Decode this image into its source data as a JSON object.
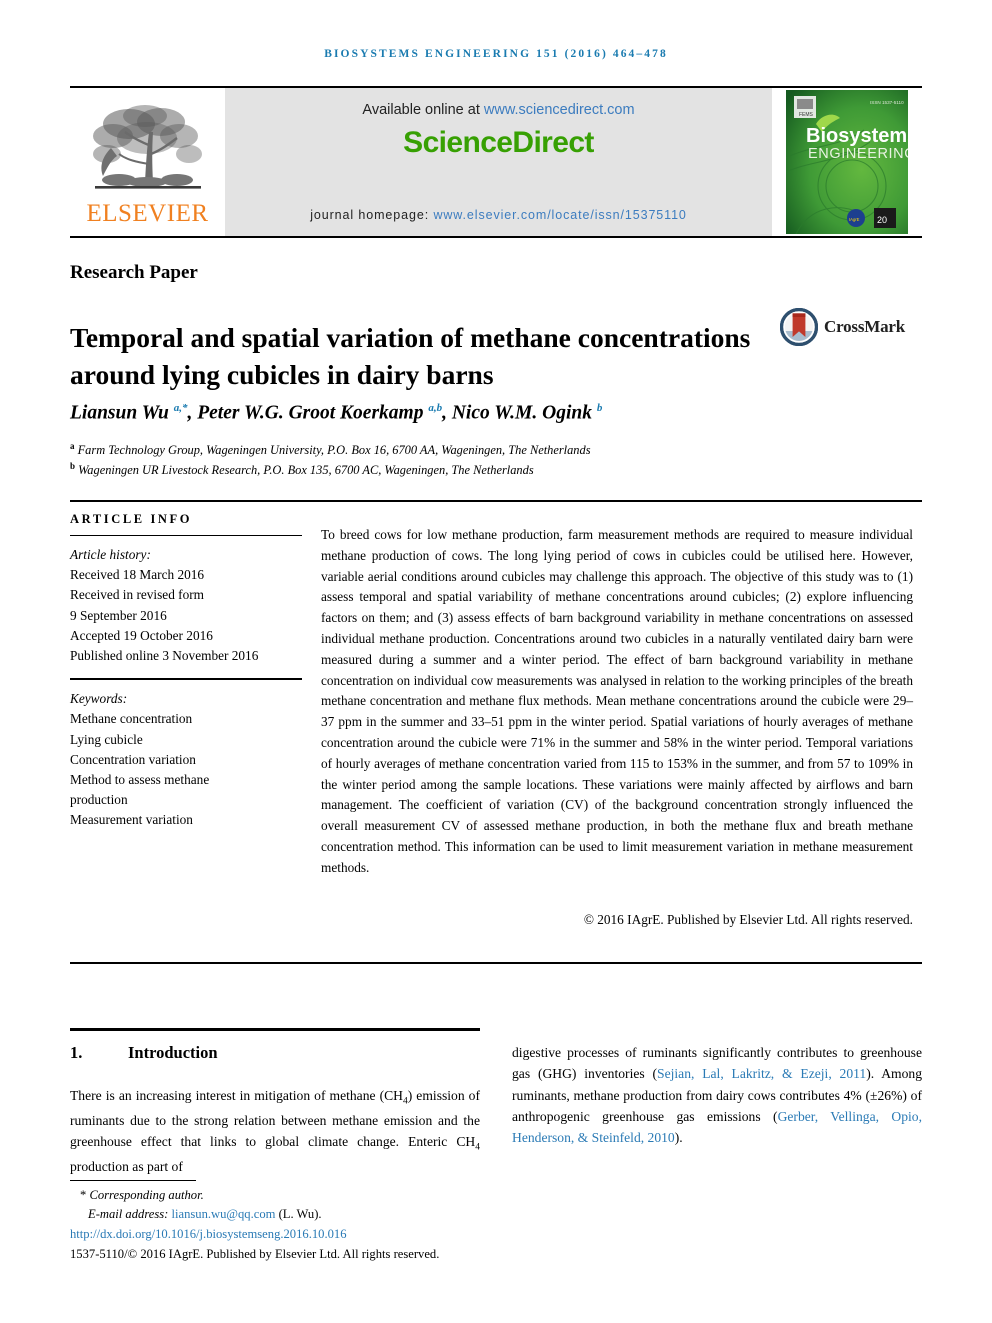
{
  "running_head": "Biosystems Engineering 151 (2016) 464–478",
  "masthead": {
    "publisher_name": "ELSEVIER",
    "available_prefix": "Available online at ",
    "available_url": "www.sciencedirect.com",
    "sciencedirect_logo": "ScienceDirect",
    "homepage_label": "journal homepage: ",
    "homepage_url": "www.elsevier.com/locate/issn/15375110",
    "cover_title_line1": "Biosystems",
    "cover_title_line2": "ENGINEERING",
    "colors": {
      "link_blue": "#3c7cbf",
      "sciencedirect_green": "#37a003",
      "elsevier_orange": "#f08020",
      "running_head_blue": "#1a7bb0",
      "cover_green": "#3d9140"
    }
  },
  "article": {
    "section_type": "Research Paper",
    "title": "Temporal and spatial variation of methane concentrations around lying cubicles in dairy barns",
    "crossmark_label": "CrossMark",
    "authors_html": "Liansun Wu <sup>a,*</sup>, Peter W.G. Groot Koerkamp <sup>a,b</sup>, Nico W.M. Ogink <sup>b</sup>",
    "affiliations": [
      "Farm Technology Group, Wageningen University, P.O. Box 16, 6700 AA, Wageningen, The Netherlands",
      "Wageningen UR Livestock Research, P.O. Box 135, 6700 AC, Wageningen, The Netherlands"
    ],
    "affiliation_markers": [
      "a",
      "b"
    ]
  },
  "article_info": {
    "heading": "ARTICLE INFO",
    "history_label": "Article history:",
    "history": [
      "Received 18 March 2016",
      "Received in revised form",
      "9 September 2016",
      "Accepted 19 October 2016",
      "Published online 3 November 2016"
    ],
    "keywords_label": "Keywords:",
    "keywords": [
      "Methane concentration",
      "Lying cubicle",
      "Concentration variation",
      "Method to assess methane",
      "production",
      "Measurement variation"
    ]
  },
  "abstract": {
    "text": "To breed cows for low methane production, farm measurement methods are required to measure individual methane production of cows. The long lying period of cows in cubicles could be utilised here. However, variable aerial conditions around cubicles may challenge this approach. The objective of this study was to (1) assess temporal and spatial variability of methane concentrations around cubicles; (2) explore influencing factors on them; and (3) assess effects of barn background variability in methane concentrations on assessed individual methane production. Concentrations around two cubicles in a naturally ventilated dairy barn were measured during a summer and a winter period. The effect of barn background variability in methane concentration on individual cow measurements was analysed in relation to the working principles of the breath methane concentration and methane flux methods. Mean methane concentrations around the cubicle were 29–37 ppm in the summer and 33–51 ppm in the winter period. Spatial variations of hourly averages of methane concentration around the cubicle were 71% in the summer and 58% in the winter period. Temporal variations of hourly averages of methane concentration varied from 115 to 153% in the summer, and from 57 to 109% in the winter period among the sample locations. These variations were mainly affected by airflows and barn management. The coefficient of variation (CV) of the background concentration strongly influenced the overall measurement CV of assessed methane production, in both the methane flux and breath methane concentration method. This information can be used to limit measurement variation in methane measurement methods.",
    "copyright": "© 2016 IAgrE. Published by Elsevier Ltd. All rights reserved."
  },
  "introduction": {
    "number": "1.",
    "heading": "Introduction",
    "left_text_part1": "There is an increasing interest in mitigation of methane (CH",
    "left_sub1": "4",
    "left_text_part2": ") emission of ruminants due to the strong relation between methane emission and the greenhouse effect that links to global climate change. Enteric CH",
    "left_sub2": "4",
    "left_text_part3": " production as part of",
    "right_text_part1": "digestive processes of ruminants significantly contributes to greenhouse gas (GHG) inventories (",
    "right_cite1": "Sejian, Lal, Lakritz, & Ezeji, 2011",
    "right_text_part2": "). Among ruminants, methane production from dairy cows contributes 4% (±26%) of anthropogenic greenhouse gas emissions (",
    "right_cite2": "Gerber, Vellinga, Opio, Henderson, & Steinfeld, 2010",
    "right_text_part3": ")."
  },
  "footnote": {
    "corresponding_star": "*",
    "corresponding_label": "Corresponding author.",
    "email_label": "E-mail address: ",
    "email": "liansun.wu@qq.com",
    "email_suffix": " (L. Wu).",
    "doi": "http://dx.doi.org/10.1016/j.biosystemseng.2016.10.016",
    "issn_line": "1537-5110/© 2016 IAgrE. Published by Elsevier Ltd. All rights reserved."
  }
}
